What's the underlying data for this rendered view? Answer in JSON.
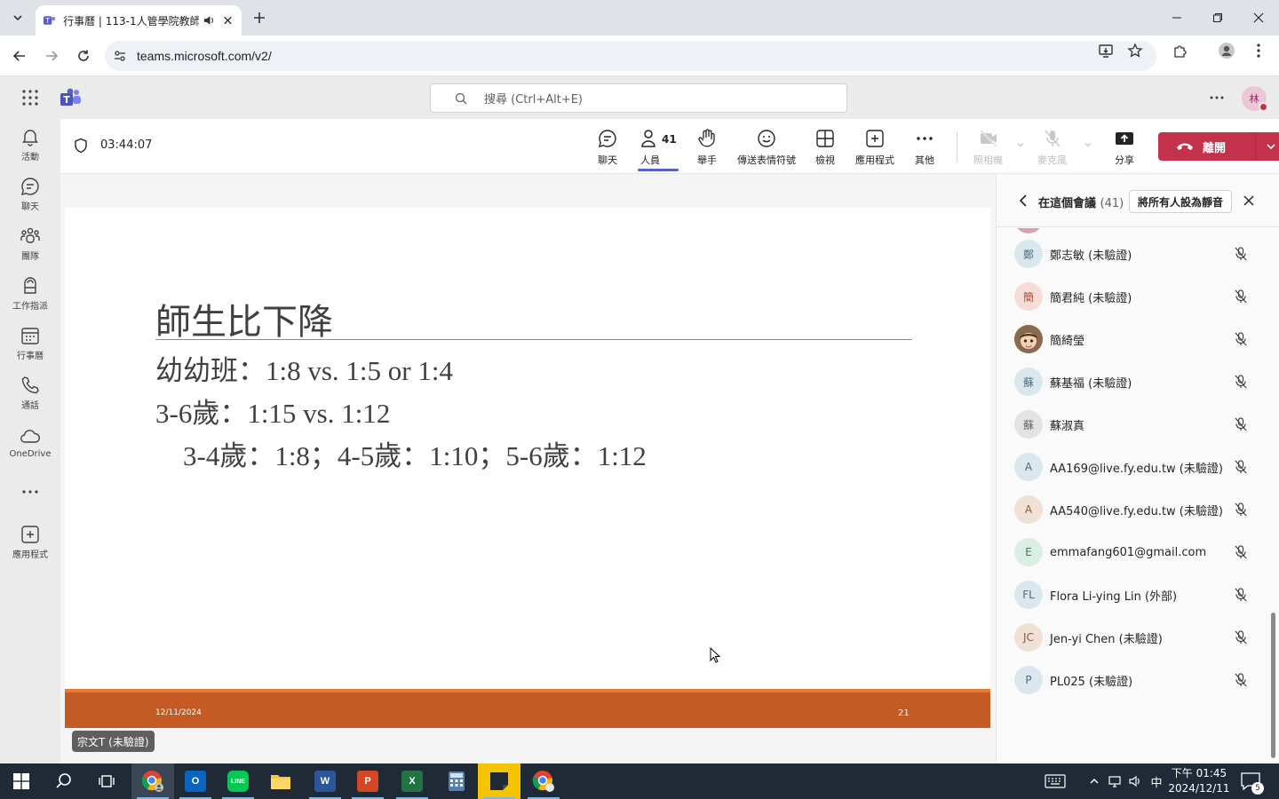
{
  "browser": {
    "tab_title": "行事曆 | 113-1人管學院教師",
    "url": "teams.microsoft.com/v2/"
  },
  "teams_header": {
    "search_placeholder": "搜尋 (Ctrl+Alt+E)",
    "user_initial": "林"
  },
  "rail": {
    "items": [
      {
        "label": "活動",
        "icon": "bell-icon"
      },
      {
        "label": "聊天",
        "icon": "chat-icon"
      },
      {
        "label": "團隊",
        "icon": "teams-icon"
      },
      {
        "label": "工作指派",
        "icon": "assignments-icon"
      },
      {
        "label": "行事曆",
        "icon": "calendar-icon"
      },
      {
        "label": "通話",
        "icon": "phone-icon"
      },
      {
        "label": "OneDrive",
        "icon": "cloud-icon"
      },
      {
        "label": "應用程式",
        "icon": "add-apps-icon"
      }
    ]
  },
  "meeting": {
    "timer": "03:44:07",
    "controls": {
      "chat": "聊天",
      "people": "人員",
      "people_count": "41",
      "raise_hand": "舉手",
      "react": "傳送表情符號",
      "view": "檢視",
      "apps": "應用程式",
      "more": "其他",
      "camera": "照相機",
      "mic": "麥克風",
      "share": "分享",
      "leave": "離開"
    }
  },
  "slide": {
    "title": "師生比下降",
    "lines": [
      "幼幼班：1:8 vs. 1:5 or 1:4",
      "3-6歲：1:15 vs. 1:12",
      "3-4歲：1:8；4-5歲：1:10；5-6歲：1:12"
    ],
    "footer_date": "12/11/2024",
    "page_number": "21",
    "presenter": "宗文T (未驗證)"
  },
  "panel": {
    "title": "在這個會議",
    "count": "(41)",
    "mute_all": "將所有人設為靜音",
    "participants": [
      {
        "initial": "鄭",
        "name": "鄭志敏 (未驗證)",
        "bg": "#dbe7ee",
        "fg": "#4a6c80"
      },
      {
        "initial": "簡",
        "name": "簡君純 (未驗證)",
        "bg": "#f6dcd6",
        "fg": "#a0523d"
      },
      {
        "initial": "",
        "name": "簡綺瑩",
        "bg": "#c9a27e",
        "fg": "#ffffff",
        "photo": true
      },
      {
        "initial": "蘇",
        "name": "蘇基福 (未驗證)",
        "bg": "#dbe7ee",
        "fg": "#4a6c80"
      },
      {
        "initial": "蘇",
        "name": "蘇淑真",
        "bg": "#e3e3e3",
        "fg": "#616161"
      },
      {
        "initial": "A",
        "name": "AA169@live.fy.edu.tw (未驗證)",
        "bg": "#dbe7ee",
        "fg": "#4a6c80"
      },
      {
        "initial": "A",
        "name": "AA540@live.fy.edu.tw (未驗證)",
        "bg": "#f1e0d6",
        "fg": "#8a5a3c"
      },
      {
        "initial": "E",
        "name": "emmafang601@gmail.com",
        "bg": "#dbeee3",
        "fg": "#3f7a57"
      },
      {
        "initial": "FL",
        "name": "Flora Li-ying Lin (外部)",
        "bg": "#dbe7ee",
        "fg": "#4a6c80"
      },
      {
        "initial": "JC",
        "name": "Jen-yi Chen (未驗證)",
        "bg": "#f1e0d6",
        "fg": "#8a5a3c"
      },
      {
        "initial": "P",
        "name": "PL025 (未驗證)",
        "bg": "#dbe7ee",
        "fg": "#4a6c80"
      }
    ]
  },
  "taskbar": {
    "time": "下午 01:45",
    "date": "2024/12/11",
    "ime": "中",
    "notification_count": "5"
  },
  "colors": {
    "teams_purple": "#5b5fc7",
    "leave_red": "#c4314b",
    "slide_footer": "#c45a24"
  }
}
